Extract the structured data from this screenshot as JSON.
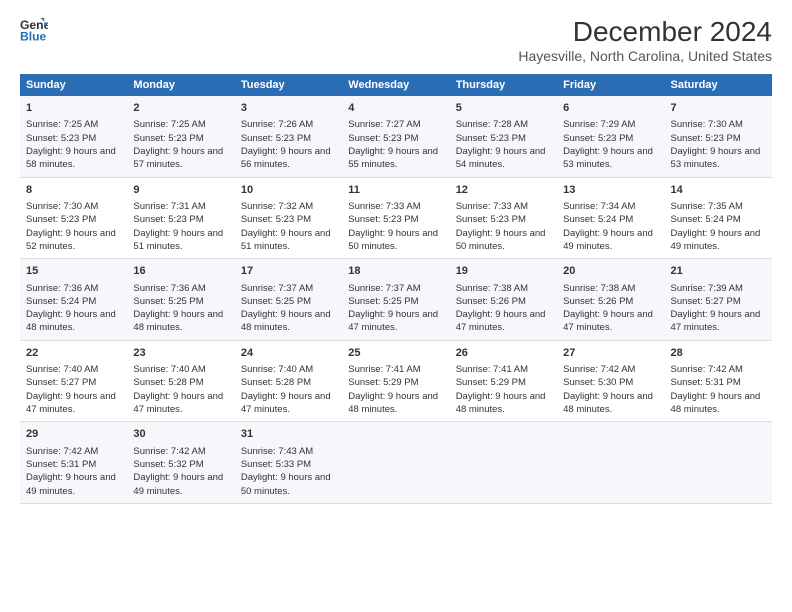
{
  "logo": {
    "line1": "General",
    "line2": "Blue"
  },
  "title": "December 2024",
  "subtitle": "Hayesville, North Carolina, United States",
  "days_of_week": [
    "Sunday",
    "Monday",
    "Tuesday",
    "Wednesday",
    "Thursday",
    "Friday",
    "Saturday"
  ],
  "weeks": [
    [
      {
        "day": "1",
        "sunrise": "7:25 AM",
        "sunset": "5:23 PM",
        "daylight": "9 hours and 58 minutes."
      },
      {
        "day": "2",
        "sunrise": "7:25 AM",
        "sunset": "5:23 PM",
        "daylight": "9 hours and 57 minutes."
      },
      {
        "day": "3",
        "sunrise": "7:26 AM",
        "sunset": "5:23 PM",
        "daylight": "9 hours and 56 minutes."
      },
      {
        "day": "4",
        "sunrise": "7:27 AM",
        "sunset": "5:23 PM",
        "daylight": "9 hours and 55 minutes."
      },
      {
        "day": "5",
        "sunrise": "7:28 AM",
        "sunset": "5:23 PM",
        "daylight": "9 hours and 54 minutes."
      },
      {
        "day": "6",
        "sunrise": "7:29 AM",
        "sunset": "5:23 PM",
        "daylight": "9 hours and 53 minutes."
      },
      {
        "day": "7",
        "sunrise": "7:30 AM",
        "sunset": "5:23 PM",
        "daylight": "9 hours and 53 minutes."
      }
    ],
    [
      {
        "day": "8",
        "sunrise": "7:30 AM",
        "sunset": "5:23 PM",
        "daylight": "9 hours and 52 minutes."
      },
      {
        "day": "9",
        "sunrise": "7:31 AM",
        "sunset": "5:23 PM",
        "daylight": "9 hours and 51 minutes."
      },
      {
        "day": "10",
        "sunrise": "7:32 AM",
        "sunset": "5:23 PM",
        "daylight": "9 hours and 51 minutes."
      },
      {
        "day": "11",
        "sunrise": "7:33 AM",
        "sunset": "5:23 PM",
        "daylight": "9 hours and 50 minutes."
      },
      {
        "day": "12",
        "sunrise": "7:33 AM",
        "sunset": "5:23 PM",
        "daylight": "9 hours and 50 minutes."
      },
      {
        "day": "13",
        "sunrise": "7:34 AM",
        "sunset": "5:24 PM",
        "daylight": "9 hours and 49 minutes."
      },
      {
        "day": "14",
        "sunrise": "7:35 AM",
        "sunset": "5:24 PM",
        "daylight": "9 hours and 49 minutes."
      }
    ],
    [
      {
        "day": "15",
        "sunrise": "7:36 AM",
        "sunset": "5:24 PM",
        "daylight": "9 hours and 48 minutes."
      },
      {
        "day": "16",
        "sunrise": "7:36 AM",
        "sunset": "5:25 PM",
        "daylight": "9 hours and 48 minutes."
      },
      {
        "day": "17",
        "sunrise": "7:37 AM",
        "sunset": "5:25 PM",
        "daylight": "9 hours and 48 minutes."
      },
      {
        "day": "18",
        "sunrise": "7:37 AM",
        "sunset": "5:25 PM",
        "daylight": "9 hours and 47 minutes."
      },
      {
        "day": "19",
        "sunrise": "7:38 AM",
        "sunset": "5:26 PM",
        "daylight": "9 hours and 47 minutes."
      },
      {
        "day": "20",
        "sunrise": "7:38 AM",
        "sunset": "5:26 PM",
        "daylight": "9 hours and 47 minutes."
      },
      {
        "day": "21",
        "sunrise": "7:39 AM",
        "sunset": "5:27 PM",
        "daylight": "9 hours and 47 minutes."
      }
    ],
    [
      {
        "day": "22",
        "sunrise": "7:40 AM",
        "sunset": "5:27 PM",
        "daylight": "9 hours and 47 minutes."
      },
      {
        "day": "23",
        "sunrise": "7:40 AM",
        "sunset": "5:28 PM",
        "daylight": "9 hours and 47 minutes."
      },
      {
        "day": "24",
        "sunrise": "7:40 AM",
        "sunset": "5:28 PM",
        "daylight": "9 hours and 47 minutes."
      },
      {
        "day": "25",
        "sunrise": "7:41 AM",
        "sunset": "5:29 PM",
        "daylight": "9 hours and 48 minutes."
      },
      {
        "day": "26",
        "sunrise": "7:41 AM",
        "sunset": "5:29 PM",
        "daylight": "9 hours and 48 minutes."
      },
      {
        "day": "27",
        "sunrise": "7:42 AM",
        "sunset": "5:30 PM",
        "daylight": "9 hours and 48 minutes."
      },
      {
        "day": "28",
        "sunrise": "7:42 AM",
        "sunset": "5:31 PM",
        "daylight": "9 hours and 48 minutes."
      }
    ],
    [
      {
        "day": "29",
        "sunrise": "7:42 AM",
        "sunset": "5:31 PM",
        "daylight": "9 hours and 49 minutes."
      },
      {
        "day": "30",
        "sunrise": "7:42 AM",
        "sunset": "5:32 PM",
        "daylight": "9 hours and 49 minutes."
      },
      {
        "day": "31",
        "sunrise": "7:43 AM",
        "sunset": "5:33 PM",
        "daylight": "9 hours and 50 minutes."
      },
      null,
      null,
      null,
      null
    ]
  ],
  "labels": {
    "sunrise": "Sunrise:",
    "sunset": "Sunset:",
    "daylight": "Daylight:"
  }
}
